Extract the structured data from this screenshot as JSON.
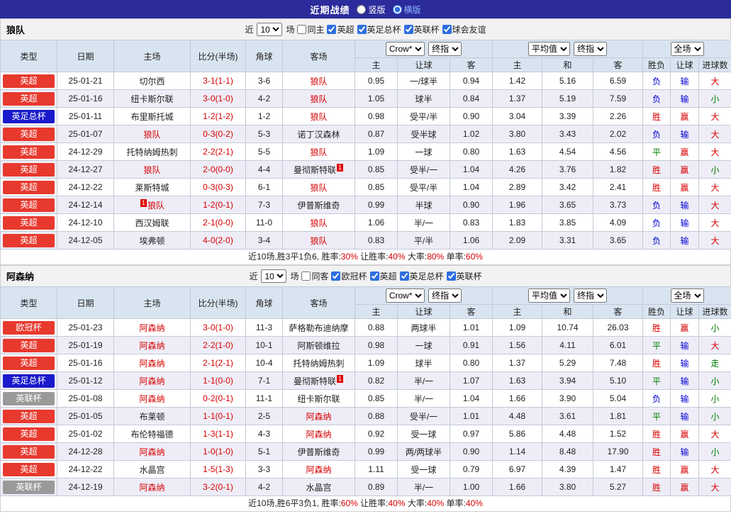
{
  "topbar": {
    "title": "近期战绩",
    "layout_options": [
      {
        "label": "竖版",
        "selected": false
      },
      {
        "label": "横版",
        "selected": true
      }
    ]
  },
  "table_headers": {
    "type": "类型",
    "date": "日期",
    "home": "主场",
    "score_half": "比分(半场)",
    "corner": "角球",
    "away": "客场",
    "odds_source": "Crow*",
    "final_index": "终指",
    "average": "平均值",
    "full": "全场",
    "home_w": "主",
    "handicap": "让球",
    "away_w": "客",
    "draw": "和",
    "win_loss": "胜负",
    "goals": "进球数"
  },
  "league_colors": {
    "英超": "#e8392e",
    "欧冠杯": "#e8392e",
    "英足总杯": "#1a1acc",
    "英联杯": "#9a9a9a"
  },
  "result_colors": {
    "胜": "#d60000",
    "赢": "#d60000",
    "大": "#d60000",
    "平": "#008000",
    "小": "#008000",
    "走": "#008000",
    "负": "#0000d6",
    "输": "#0000d6"
  },
  "sections": [
    {
      "team": "狼队",
      "filter": {
        "recent_label": "近",
        "count": "10",
        "matches_label": "场",
        "checkboxes": [
          {
            "label": "同主",
            "checked": false
          },
          {
            "label": "英超",
            "checked": true
          },
          {
            "label": "英足总杯",
            "checked": true
          },
          {
            "label": "英联杯",
            "checked": true
          },
          {
            "label": "球会友谊",
            "checked": true
          }
        ]
      },
      "rows": [
        {
          "league": "英超",
          "date": "25-01-21",
          "home": {
            "name": "切尔西"
          },
          "score": "3-1(1-1)",
          "corner": "3-6",
          "away": {
            "name": "狼队",
            "hot": true
          },
          "w1": "0.95",
          "handicap": "一/球半",
          "w2": "0.94",
          "a1": "1.42",
          "a2": "5.16",
          "a3": "6.59",
          "r1": "负",
          "r2": "输",
          "r3": "大"
        },
        {
          "league": "英超",
          "date": "25-01-16",
          "home": {
            "name": "纽卡斯尔联"
          },
          "score": "3-0(1-0)",
          "corner": "4-2",
          "away": {
            "name": "狼队",
            "hot": true
          },
          "w1": "1.05",
          "handicap": "球半",
          "w2": "0.84",
          "a1": "1.37",
          "a2": "5.19",
          "a3": "7.59",
          "r1": "负",
          "r2": "输",
          "r3": "小"
        },
        {
          "league": "英足总杯",
          "date": "25-01-11",
          "home": {
            "name": "布里斯托城"
          },
          "score": "1-2(1-2)",
          "corner": "1-2",
          "away": {
            "name": "狼队",
            "hot": true
          },
          "w1": "0.98",
          "handicap": "受平/半",
          "w2": "0.90",
          "a1": "3.04",
          "a2": "3.39",
          "a3": "2.26",
          "r1": "胜",
          "r2": "赢",
          "r3": "大"
        },
        {
          "league": "英超",
          "date": "25-01-07",
          "home": {
            "name": "狼队",
            "hot": true
          },
          "score": "0-3(0-2)",
          "corner": "5-3",
          "away": {
            "name": "诺丁汉森林"
          },
          "w1": "0.87",
          "handicap": "受半球",
          "w2": "1.02",
          "a1": "3.80",
          "a2": "3.43",
          "a3": "2.02",
          "r1": "负",
          "r2": "输",
          "r3": "大"
        },
        {
          "league": "英超",
          "date": "24-12-29",
          "home": {
            "name": "托特纳姆热刺"
          },
          "score": "2-2(2-1)",
          "corner": "5-5",
          "away": {
            "name": "狼队",
            "hot": true
          },
          "w1": "1.09",
          "handicap": "一球",
          "w2": "0.80",
          "a1": "1.63",
          "a2": "4.54",
          "a3": "4.56",
          "r1": "平",
          "r2": "赢",
          "r3": "大"
        },
        {
          "league": "英超",
          "date": "24-12-27",
          "home": {
            "name": "狼队",
            "hot": true
          },
          "score": "2-0(0-0)",
          "corner": "4-4",
          "away": {
            "name": "曼彻斯特联",
            "badge": "1"
          },
          "w1": "0.85",
          "handicap": "受半/一",
          "w2": "1.04",
          "a1": "4.26",
          "a2": "3.76",
          "a3": "1.82",
          "r1": "胜",
          "r2": "赢",
          "r3": "小"
        },
        {
          "league": "英超",
          "date": "24-12-22",
          "home": {
            "name": "莱斯特城"
          },
          "score": "0-3(0-3)",
          "corner": "6-1",
          "away": {
            "name": "狼队",
            "hot": true
          },
          "w1": "0.85",
          "handicap": "受平/半",
          "w2": "1.04",
          "a1": "2.89",
          "a2": "3.42",
          "a3": "2.41",
          "r1": "胜",
          "r2": "赢",
          "r3": "大"
        },
        {
          "league": "英超",
          "date": "24-12-14",
          "home": {
            "name": "狼队",
            "hot": true,
            "badge": "1",
            "badge_pos": "before"
          },
          "score": "1-2(0-1)",
          "corner": "7-3",
          "away": {
            "name": "伊普斯维奇"
          },
          "w1": "0.99",
          "handicap": "半球",
          "w2": "0.90",
          "a1": "1.96",
          "a2": "3.65",
          "a3": "3.73",
          "r1": "负",
          "r2": "输",
          "r3": "大"
        },
        {
          "league": "英超",
          "date": "24-12-10",
          "home": {
            "name": "西汉姆联"
          },
          "score": "2-1(0-0)",
          "corner": "11-0",
          "away": {
            "name": "狼队",
            "hot": true
          },
          "w1": "1.06",
          "handicap": "半/一",
          "w2": "0.83",
          "a1": "1.83",
          "a2": "3.85",
          "a3": "4.09",
          "r1": "负",
          "r2": "输",
          "r3": "大"
        },
        {
          "league": "英超",
          "date": "24-12-05",
          "home": {
            "name": "埃弗顿"
          },
          "score": "4-0(2-0)",
          "corner": "3-4",
          "away": {
            "name": "狼队",
            "hot": true
          },
          "w1": "0.83",
          "handicap": "平/半",
          "w2": "1.06",
          "a1": "2.09",
          "a2": "3.31",
          "a3": "3.65",
          "r1": "负",
          "r2": "输",
          "r3": "大"
        }
      ],
      "summary": {
        "prefix": "近10场,胜3平1负6, ",
        "stats": [
          {
            "label": "胜率:",
            "value": "30%"
          },
          {
            "label": " 让胜率:",
            "value": "40%"
          },
          {
            "label": " 大率:",
            "value": "80%"
          },
          {
            "label": " 单率:",
            "value": "60%"
          }
        ]
      }
    },
    {
      "team": "阿森纳",
      "filter": {
        "recent_label": "近",
        "count": "10",
        "matches_label": "场",
        "checkboxes": [
          {
            "label": "同客",
            "checked": false
          },
          {
            "label": "欧冠杯",
            "checked": true
          },
          {
            "label": "英超",
            "checked": true
          },
          {
            "label": "英足总杯",
            "checked": true
          },
          {
            "label": "英联杯",
            "checked": true
          }
        ]
      },
      "rows": [
        {
          "league": "欧冠杯",
          "date": "25-01-23",
          "home": {
            "name": "阿森纳",
            "hot": true
          },
          "score": "3-0(1-0)",
          "corner": "11-3",
          "away": {
            "name": "萨格勒布迪纳摩"
          },
          "w1": "0.88",
          "handicap": "两球半",
          "w2": "1.01",
          "a1": "1.09",
          "a2": "10.74",
          "a3": "26.03",
          "r1": "胜",
          "r2": "赢",
          "r3": "小"
        },
        {
          "league": "英超",
          "date": "25-01-19",
          "home": {
            "name": "阿森纳",
            "hot": true
          },
          "score": "2-2(1-0)",
          "corner": "10-1",
          "away": {
            "name": "阿斯顿维拉"
          },
          "w1": "0.98",
          "handicap": "一球",
          "w2": "0.91",
          "a1": "1.56",
          "a2": "4.11",
          "a3": "6.01",
          "r1": "平",
          "r2": "输",
          "r3": "大"
        },
        {
          "league": "英超",
          "date": "25-01-16",
          "home": {
            "name": "阿森纳",
            "hot": true
          },
          "score": "2-1(2-1)",
          "corner": "10-4",
          "away": {
            "name": "托特纳姆热刺"
          },
          "w1": "1.09",
          "handicap": "球半",
          "w2": "0.80",
          "a1": "1.37",
          "a2": "5.29",
          "a3": "7.48",
          "r1": "胜",
          "r2": "输",
          "r3": "走"
        },
        {
          "league": "英足总杯",
          "date": "25-01-12",
          "home": {
            "name": "阿森纳",
            "hot": true
          },
          "score": "1-1(0-0)",
          "corner": "7-1",
          "away": {
            "name": "曼彻斯特联",
            "badge": "1"
          },
          "w1": "0.82",
          "handicap": "半/一",
          "w2": "1.07",
          "a1": "1.63",
          "a2": "3.94",
          "a3": "5.10",
          "r1": "平",
          "r2": "输",
          "r3": "小"
        },
        {
          "league": "英联杯",
          "date": "25-01-08",
          "home": {
            "name": "阿森纳",
            "hot": true
          },
          "score": "0-2(0-1)",
          "corner": "11-1",
          "away": {
            "name": "纽卡斯尔联"
          },
          "w1": "0.85",
          "handicap": "半/一",
          "w2": "1.04",
          "a1": "1.66",
          "a2": "3.90",
          "a3": "5.04",
          "r1": "负",
          "r2": "输",
          "r3": "小"
        },
        {
          "league": "英超",
          "date": "25-01-05",
          "home": {
            "name": "布莱顿"
          },
          "score": "1-1(0-1)",
          "corner": "2-5",
          "away": {
            "name": "阿森纳",
            "hot": true
          },
          "w1": "0.88",
          "handicap": "受半/一",
          "w2": "1.01",
          "a1": "4.48",
          "a2": "3.61",
          "a3": "1.81",
          "r1": "平",
          "r2": "输",
          "r3": "小"
        },
        {
          "league": "英超",
          "date": "25-01-02",
          "home": {
            "name": "布伦特福德"
          },
          "score": "1-3(1-1)",
          "corner": "4-3",
          "away": {
            "name": "阿森纳",
            "hot": true
          },
          "w1": "0.92",
          "handicap": "受一球",
          "w2": "0.97",
          "a1": "5.86",
          "a2": "4.48",
          "a3": "1.52",
          "r1": "胜",
          "r2": "赢",
          "r3": "大"
        },
        {
          "league": "英超",
          "date": "24-12-28",
          "home": {
            "name": "阿森纳",
            "hot": true
          },
          "score": "1-0(1-0)",
          "corner": "5-1",
          "away": {
            "name": "伊普斯维奇"
          },
          "w1": "0.99",
          "handicap": "两/两球半",
          "w2": "0.90",
          "a1": "1.14",
          "a2": "8.48",
          "a3": "17.90",
          "r1": "胜",
          "r2": "输",
          "r3": "小"
        },
        {
          "league": "英超",
          "date": "24-12-22",
          "home": {
            "name": "水晶宫"
          },
          "score": "1-5(1-3)",
          "corner": "3-3",
          "away": {
            "name": "阿森纳",
            "hot": true
          },
          "w1": "1.11",
          "handicap": "受一球",
          "w2": "0.79",
          "a1": "6.97",
          "a2": "4.39",
          "a3": "1.47",
          "r1": "胜",
          "r2": "赢",
          "r3": "大"
        },
        {
          "league": "英联杯",
          "date": "24-12-19",
          "home": {
            "name": "阿森纳",
            "hot": true
          },
          "score": "3-2(0-1)",
          "corner": "4-2",
          "away": {
            "name": "水晶宫"
          },
          "w1": "0.89",
          "handicap": "半/一",
          "w2": "1.00",
          "a1": "1.66",
          "a2": "3.80",
          "a3": "5.27",
          "r1": "胜",
          "r2": "赢",
          "r3": "大"
        }
      ],
      "summary": {
        "prefix": "近10场,胜6平3负1, ",
        "stats": [
          {
            "label": "胜率:",
            "value": "60%"
          },
          {
            "label": " 让胜率:",
            "value": "40%"
          },
          {
            "label": " 大率:",
            "value": "40%"
          },
          {
            "label": " 单率:",
            "value": "40%"
          }
        ]
      }
    }
  ]
}
